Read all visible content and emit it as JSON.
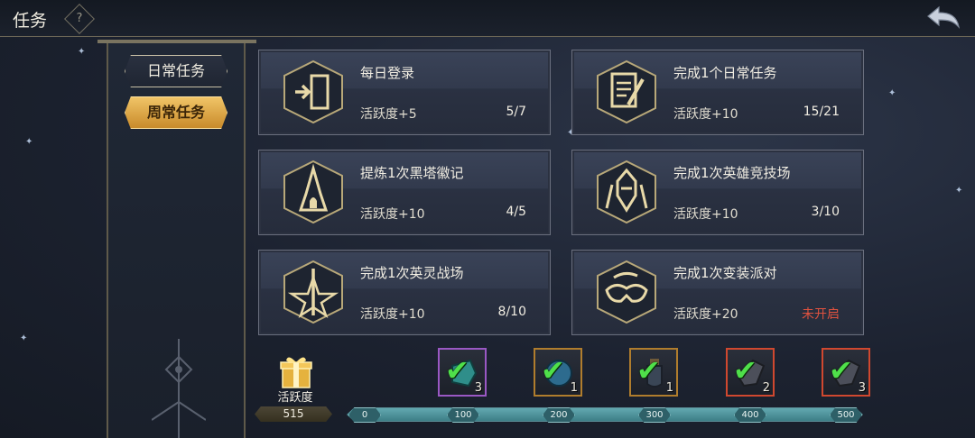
{
  "header": {
    "title": "任务",
    "help_icon": "question-gear-icon",
    "back_icon": "back-arrow-icon"
  },
  "tabs": [
    {
      "label": "日常任务",
      "active": false
    },
    {
      "label": "周常任务",
      "active": true
    }
  ],
  "tasks": [
    {
      "name": "每日登录",
      "reward": "活跃度+5",
      "progress": "5/7",
      "icon": "door-enter-icon"
    },
    {
      "name": "完成1个日常任务",
      "reward": "活跃度+10",
      "progress": "15/21",
      "icon": "scroll-quill-icon"
    },
    {
      "name": "提炼1次黑塔徽记",
      "reward": "活跃度+10",
      "progress": "4/5",
      "icon": "black-tower-icon"
    },
    {
      "name": "完成1次英雄竞技场",
      "reward": "活跃度+10",
      "progress": "3/10",
      "icon": "knight-helmet-icon"
    },
    {
      "name": "完成1次英灵战场",
      "reward": "活跃度+10",
      "progress": "8/10",
      "icon": "sword-star-icon"
    },
    {
      "name": "完成1次变装派对",
      "reward": "活跃度+20",
      "progress": "未开启",
      "icon": "masquerade-mask-icon"
    }
  ],
  "activity": {
    "label": "活跃度",
    "score": "515",
    "icon": "gift-box-icon",
    "max": 500,
    "fill_fraction": 1.0,
    "ticks": [
      "0",
      "100",
      "200",
      "300",
      "400",
      "500"
    ]
  },
  "rewards": [
    {
      "count": "3",
      "rarity": "purple",
      "claimed": true,
      "icon": "teal-crystal-icon"
    },
    {
      "count": "1",
      "rarity": "orange",
      "claimed": true,
      "icon": "blue-shield-gem-icon"
    },
    {
      "count": "1",
      "rarity": "orange",
      "claimed": true,
      "icon": "potion-bottle-icon"
    },
    {
      "count": "2",
      "rarity": "red",
      "claimed": true,
      "icon": "dark-crystal-icon"
    },
    {
      "count": "3",
      "rarity": "red",
      "claimed": true,
      "icon": "dark-crystal-icon"
    }
  ],
  "colors": {
    "accent_gold": "#e8b35a",
    "locked_red": "#e0523f",
    "check_green": "#4fe04a",
    "progress_teal": "#4f969e"
  }
}
